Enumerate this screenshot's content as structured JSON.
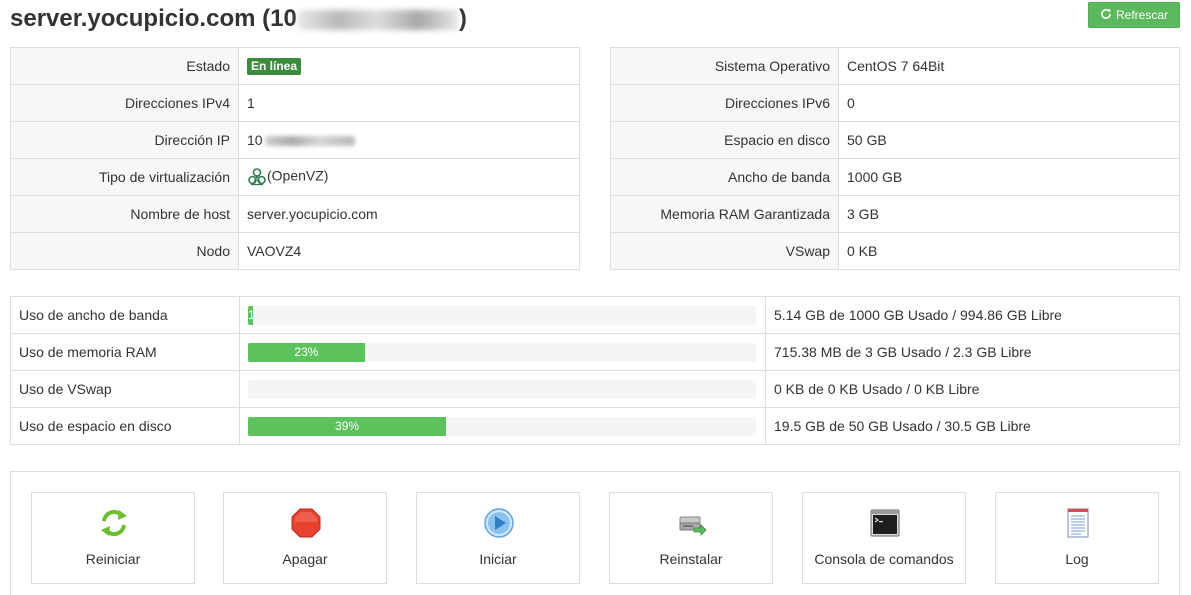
{
  "header": {
    "title_prefix": "server.yocupicio.com (10",
    "title_suffix": ")",
    "refresh_label": "Refrescar"
  },
  "info_left": [
    {
      "label": "Estado",
      "value": "En línea"
    },
    {
      "label": "Direcciones IPv4",
      "value": "1"
    },
    {
      "label": "Dirección IP",
      "value": "10"
    },
    {
      "label": "Tipo de virtualización",
      "value": "(OpenVZ)"
    },
    {
      "label": "Nombre de host",
      "value": "server.yocupicio.com"
    },
    {
      "label": "Nodo",
      "value": "VAOVZ4"
    }
  ],
  "info_right": [
    {
      "label": "Sistema Operativo",
      "value": "CentOS 7 64Bit"
    },
    {
      "label": "Direcciones IPv6",
      "value": "0"
    },
    {
      "label": "Espacio en disco",
      "value": "50 GB"
    },
    {
      "label": "Ancho de banda",
      "value": "1000 GB"
    },
    {
      "label": "Memoria RAM Garantizada",
      "value": "3 GB"
    },
    {
      "label": "VSwap",
      "value": "0 KB"
    }
  ],
  "usage": [
    {
      "label": "Uso de ancho de banda",
      "percent": 1,
      "percent_label": "1%",
      "detail": "5.14 GB de 1000 GB Usado / 994.86 GB Libre"
    },
    {
      "label": "Uso de memoria RAM",
      "percent": 23,
      "percent_label": "23%",
      "detail": "715.38 MB de 3 GB Usado / 2.3 GB Libre"
    },
    {
      "label": "Uso de VSwap",
      "percent": 0,
      "percent_label": "0%",
      "detail": "0 KB de 0 KB Usado / 0 KB Libre"
    },
    {
      "label": "Uso de espacio en disco",
      "percent": 39,
      "percent_label": "39%",
      "detail": "19.5 GB de 50 GB Usado / 30.5 GB Libre"
    }
  ],
  "actions": [
    {
      "label": "Reiniciar",
      "icon": "reboot-icon"
    },
    {
      "label": "Apagar",
      "icon": "stop-icon"
    },
    {
      "label": "Iniciar",
      "icon": "play-icon"
    },
    {
      "label": "Reinstalar",
      "icon": "reinstall-icon"
    },
    {
      "label": "Consola de comandos",
      "icon": "console-icon"
    },
    {
      "label": "Log",
      "icon": "log-icon"
    }
  ],
  "colors": {
    "accent_green": "#5cb85c",
    "badge_green": "#3c8a3c",
    "bar_fill": "#5cc25c",
    "stop_red": "#e8412e",
    "play_blue": "#5aa3e0"
  }
}
